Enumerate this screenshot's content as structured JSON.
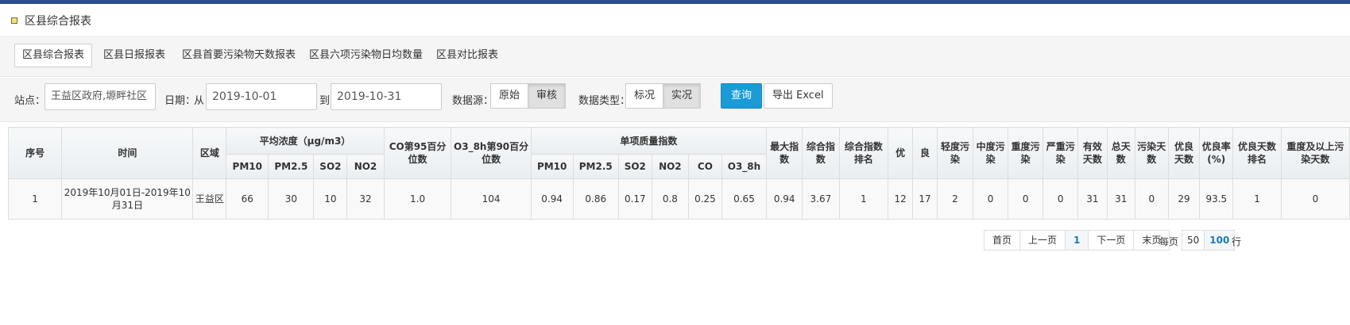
{
  "page": {
    "title": "区县综合报表"
  },
  "tabs": [
    {
      "label": "区县综合报表",
      "active": true
    },
    {
      "label": "区县日报报表"
    },
    {
      "label": "区县首要污染物天数报表"
    },
    {
      "label": "区县六项污染物日均数量"
    },
    {
      "label": "区县对比报表"
    }
  ],
  "filters": {
    "station_label": "站点：",
    "station_value": "王益区政府,塬畔社区",
    "date_label": "日期：",
    "from_label": "从",
    "from_value": "2019-10-01",
    "to_label": "到",
    "to_value": "2019-10-31",
    "source_label": "数据源：",
    "source_options": [
      "原始",
      "审核"
    ],
    "source_selected": "审核",
    "type_label": "数据类型：",
    "type_options": [
      "标况",
      "实况"
    ],
    "type_selected": "实况",
    "query_label": "查询",
    "export_label": "导出 Excel"
  },
  "table": {
    "headers": {
      "seq": "序号",
      "time": "时间",
      "region": "区域",
      "avg_conc": "平均浓度（μg/m3）",
      "avg_cols": [
        "PM10",
        "PM2.5",
        "SO2",
        "NO2"
      ],
      "co95": "CO第95百分位数",
      "o3_90": "O3_8h第90百分位数",
      "single_index": "单项质量指数",
      "single_cols": [
        "PM10",
        "PM2.5",
        "SO2",
        "NO2",
        "CO",
        "O3_8h"
      ],
      "max_index": "最大指数",
      "composite_index": "综合指数",
      "composite_rank": "综合指数排名",
      "excellent": "优",
      "good": "良",
      "light": "轻度污染",
      "moderate": "中度污染",
      "heavy": "重度污染",
      "severe": "严重污染",
      "valid_days": "有效天数",
      "total_days": "总天数",
      "polluted_days": "污染天数",
      "good_days": "优良天数",
      "good_rate": "优良率(%)",
      "good_days_rank": "优良天数排名",
      "heavy_above_days": "重度及以上污染天数"
    },
    "rows": [
      {
        "seq": "1",
        "time": "2019年10月01日-2019年10月31日",
        "region": "王益区",
        "avg": [
          "66",
          "30",
          "10",
          "32"
        ],
        "co95": "1.0",
        "o3_90": "104",
        "single": [
          "0.94",
          "0.86",
          "0.17",
          "0.8",
          "0.25",
          "0.65"
        ],
        "max_index": "0.94",
        "composite_index": "3.67",
        "composite_rank": "1",
        "excellent": "12",
        "good": "17",
        "light": "2",
        "moderate": "0",
        "heavy": "0",
        "severe": "0",
        "valid_days": "31",
        "total_days": "31",
        "polluted_days": "0",
        "good_days": "29",
        "good_rate": "93.5",
        "good_days_rank": "1",
        "heavy_above_days": "0"
      }
    ]
  },
  "pager": {
    "first": "首页",
    "prev": "上一页",
    "current": "1",
    "next": "下一页",
    "last": "末页",
    "per_page_label": "每页",
    "sizes": [
      "50",
      "100"
    ],
    "size_selected": "100",
    "rows_label": "行"
  }
}
